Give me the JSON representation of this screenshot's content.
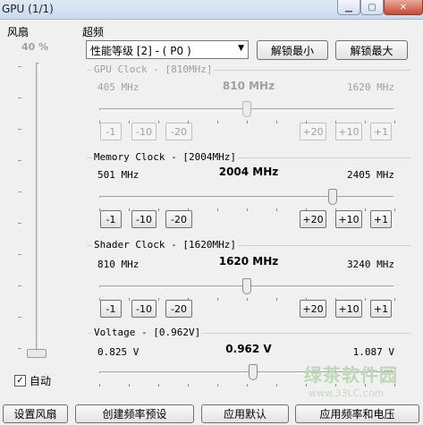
{
  "window": {
    "title": "GPU (1/1)"
  },
  "fan": {
    "section_label": "风扇",
    "value": "40 %",
    "auto_label": "自动",
    "auto_checked": "✓",
    "level_percent": 40
  },
  "overclock": {
    "section_label": "超频",
    "perf_level": {
      "selected": "性能等级 [2] - ( P0 )"
    },
    "unlock_min_label": "解锁最小",
    "unlock_max_label": "解锁最大"
  },
  "groups": [
    {
      "label": "GPU Clock - [810MHz]",
      "min": "405 MHz",
      "current": "810 MHz",
      "max": "1620 MHz",
      "disabled": true,
      "position": 0.5,
      "btn_m1": "-1",
      "btn_m10": "-10",
      "btn_m20": "-20",
      "btn_p20": "+20",
      "btn_p10": "+10",
      "btn_p1": "+1"
    },
    {
      "label": "Memory Clock - [2004MHz]",
      "min": "501 MHz",
      "current": "2004 MHz",
      "max": "2405 MHz",
      "disabled": false,
      "position": 0.79,
      "btn_m1": "-1",
      "btn_m10": "-10",
      "btn_m20": "-20",
      "btn_p20": "+20",
      "btn_p10": "+10",
      "btn_p1": "+1"
    },
    {
      "label": "Shader Clock - [1620MHz]",
      "min": "810 MHz",
      "current": "1620 MHz",
      "max": "3240 MHz",
      "disabled": false,
      "position": 0.5,
      "btn_m1": "-1",
      "btn_m10": "-10",
      "btn_m20": "-20",
      "btn_p20": "+20",
      "btn_p10": "+10",
      "btn_p1": "+1"
    },
    {
      "label": "Voltage - [0.962V]",
      "min": "0.825 V",
      "current": "0.962 V",
      "max": "1.087 V",
      "disabled": false,
      "position": 0.52
    }
  ],
  "bottom_buttons": {
    "set_fan": "设置风扇",
    "create_preset": "创建频率预设",
    "apply_default": "应用默认",
    "apply_freq_voltage": "应用频率和电压"
  },
  "watermark": {
    "text": "绿茶软件园",
    "url": "www.33LC.com"
  }
}
